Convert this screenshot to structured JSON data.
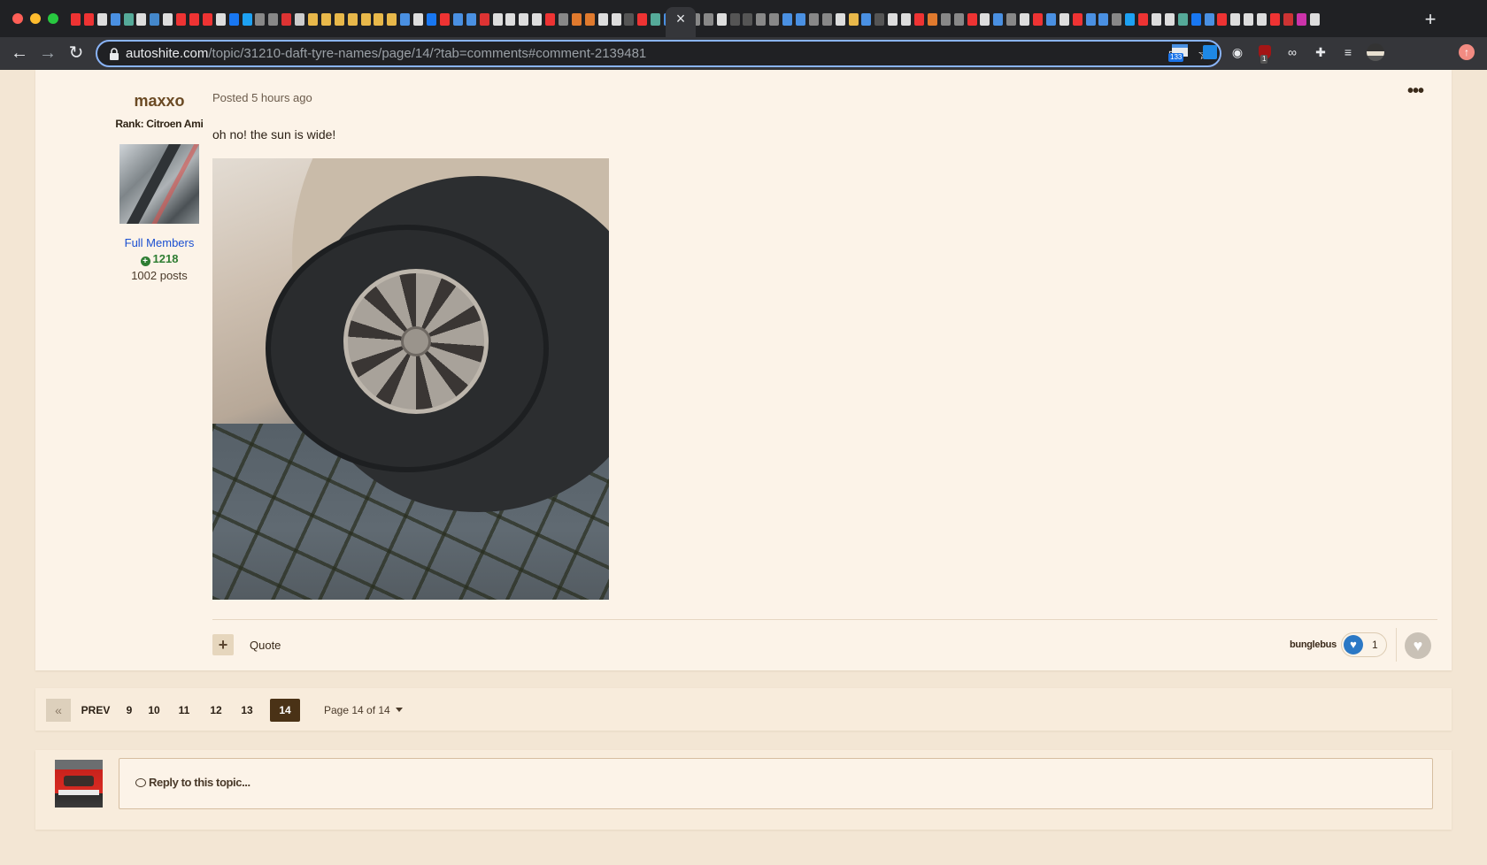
{
  "browser": {
    "url_host": "autoshite.com",
    "url_path": "/topic/31210-daft-tyre-names/page/14/?tab=comments#comment-2139481",
    "extension_badge": "133",
    "extension_badge_2": "1",
    "tab_favicon_colors": [
      "#e33",
      "#e33",
      "#ddd",
      "#4a90e2",
      "#5a9",
      "#ddd",
      "#48c",
      "#ddd",
      "#e33",
      "#e33",
      "#e33",
      "#ddd",
      "#1877f2",
      "#1da1f2",
      "#888",
      "#888",
      "#d33",
      "#ccc",
      "#e8b84a",
      "#e8b84a",
      "#e8b84a",
      "#e8b84a",
      "#e8b84a",
      "#e8b84a",
      "#e8b84a",
      "#4a90e2",
      "#ddd",
      "#1877f2",
      "#e33",
      "#4a90e2",
      "#4a90e2",
      "#d33",
      "#ddd",
      "#ddd",
      "#ddd",
      "#ddd",
      "#e33",
      "#888",
      "#e07a2e",
      "#e07a2e",
      "#ddd",
      "#ddd",
      "#555",
      "#e33",
      "#5a9",
      "#4a90e2",
      "#4a90e2",
      "#888",
      "#888",
      "#ddd",
      "#555",
      "#555",
      "#888",
      "#888",
      "#4a90e2",
      "#4a90e2",
      "#888",
      "#888",
      "#ddd",
      "#e8b84a",
      "#4a90e2",
      "#555",
      "#ddd",
      "#ddd",
      "#e33",
      "#e07a2e",
      "#888",
      "#888",
      "#e33",
      "#ddd",
      "#4a90e2",
      "#888",
      "#ddd",
      "#e33",
      "#4a90e2",
      "#ddd",
      "#e33",
      "#4a90e2",
      "#4a90e2",
      "#888",
      "#1da1f2",
      "#e33",
      "#ddd",
      "#ddd",
      "#5a9",
      "#1877f2",
      "#4a90e2",
      "#e33",
      "#ddd",
      "#ddd",
      "#ddd",
      "#e33",
      "#c33",
      "#c3a",
      "#ddd"
    ]
  },
  "post": {
    "author_name": "maxxo",
    "author_rank": "Rank: Citroen Ami",
    "member_group": "Full Members",
    "reputation": "1218",
    "post_count": "1002 posts",
    "posted": "Posted 5 hours ago",
    "body": "oh no! the sun is wide!",
    "quote_label": "Quote",
    "reaction_user": "bunglebus",
    "reaction_count": "1"
  },
  "pagination": {
    "prev_label": "PREV",
    "pages": [
      "9",
      "10",
      "11",
      "12",
      "13"
    ],
    "current": "14",
    "jump_label": "Page 14 of 14"
  },
  "reply": {
    "placeholder": "Reply to this topic..."
  },
  "colors": {
    "accent": "#4a3216",
    "page_bg": "#f3e6d4",
    "reaction_blue": "#2b78c5",
    "member_link": "#1a4fd1",
    "reputation_green": "#2e7d32"
  }
}
